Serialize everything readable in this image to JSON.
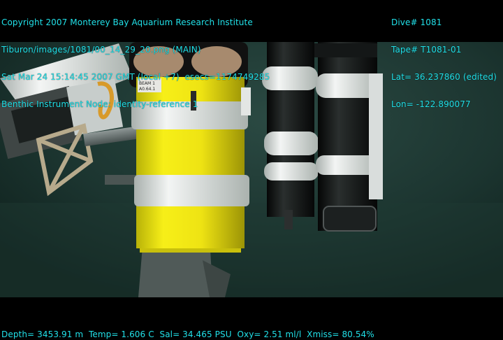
{
  "overlay": {
    "left_lines": [
      "Copyright 2007 Monterey Bay Aquarium Research Institute",
      "Tiburon/images/1081/00_14_29_20.png (MAIN)",
      "Sat Mar 24 15:14:45 2007 GMT (local +7)  esecs=1174749285",
      "Benthic Instrument Node: identity-reference 1"
    ],
    "right_lines": [
      "Dive# 1081",
      "Tape# T1081-01",
      "Lat= 36.237860 (edited)",
      "Lon= -122.890077"
    ],
    "footer": "Depth= 3453.91 m  Temp= 1.606 C  Sal= 34.465 PSU  Oxy= 2.51 ml/l  Xmiss= 80.54%"
  },
  "scene": {
    "description_colors": {
      "water": "#1d3a34",
      "yellow_canister": "#f2ea10",
      "white_bands": "#e8ecea",
      "black_tubes": "#0c0f0f",
      "text_overlay": "#21e0e8"
    },
    "canister_label_text": [
      "BEAM 1",
      "A0.64.1"
    ]
  }
}
